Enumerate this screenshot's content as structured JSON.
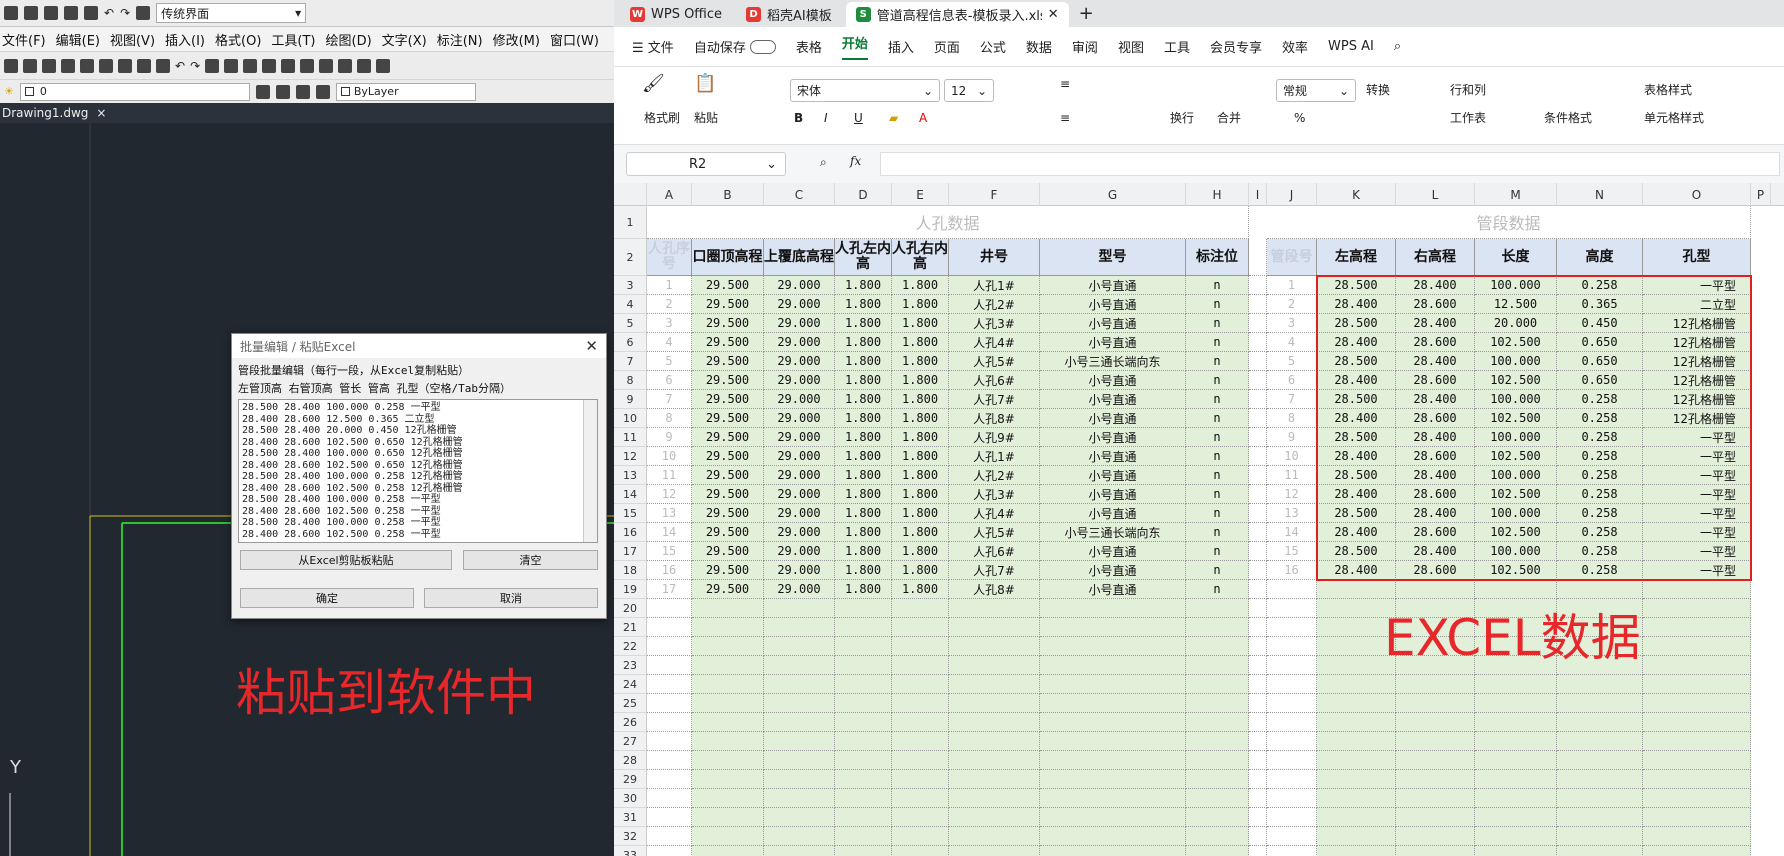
{
  "cad": {
    "workspace": "传统界面",
    "menu": [
      "文件(F)",
      "编辑(E)",
      "视图(V)",
      "插入(I)",
      "格式(O)",
      "工具(T)",
      "绘图(D)",
      "文字(X)",
      "标注(N)",
      "修改(M)",
      "窗口(W)"
    ],
    "layer_value": "0",
    "linetype": "ByLayer",
    "file_tab": "Drawing1.dwg",
    "axis_label": "Y",
    "dialog": {
      "title": "批量编辑 / 粘贴Excel",
      "desc": "管段批量编辑（每行一段，从Excel复制粘贴）",
      "columns": "左管顶高 右管顶高 管长 管高 孔型（空格/Tab分隔）",
      "lines": [
        "28.500 28.400 100.000 0.258 一平型",
        "28.400 28.600 12.500 0.365 二立型",
        "28.500 28.400 20.000 0.450 12孔格栅管",
        "28.400 28.600 102.500 0.650 12孔格栅管",
        "28.500 28.400 100.000 0.650 12孔格栅管",
        "28.400 28.600 102.500 0.650 12孔格栅管",
        "28.500 28.400 100.000 0.258 12孔格栅管",
        "28.400 28.600 102.500 0.258 12孔格栅管",
        "28.500 28.400 100.000 0.258 一平型",
        "28.400 28.600 102.500 0.258 一平型",
        "28.500 28.400 100.000 0.258 一平型",
        "28.400 28.600 102.500 0.258 一平型"
      ],
      "paste_button": "从Excel剪贴板粘贴",
      "clear_button": "清空",
      "ok_button": "确定",
      "cancel_button": "取消"
    },
    "note": "粘贴到软件中"
  },
  "wps": {
    "tabs": [
      "WPS Office",
      "稻壳AI模板",
      "管道高程信息表-模板录入.xls"
    ],
    "menu": [
      "文件",
      "自动保存",
      "表格",
      "开始",
      "插入",
      "页面",
      "公式",
      "数据",
      "审阅",
      "视图",
      "工具",
      "会员专享",
      "效率",
      "WPS AI"
    ],
    "ribbon": {
      "format_painter": "格式刷",
      "paste": "粘贴",
      "font": "宋体",
      "size": "12",
      "wrap": "换行",
      "merge": "合并",
      "number_format": "常规",
      "convert": "转换",
      "row_col": "行和列",
      "sheet": "工作表",
      "cond_format": "条件格式",
      "table_style": "表格样式",
      "cell_style": "单元格样式"
    },
    "name_box": "R2",
    "fx": "fx",
    "columns": [
      "A",
      "B",
      "C",
      "D",
      "E",
      "F",
      "G",
      "H",
      "I",
      "J",
      "K",
      "L",
      "M",
      "N",
      "O",
      "P"
    ],
    "group1": "人孔数据",
    "group2": "管段数据",
    "headers": [
      "人孔序号",
      "口圈顶高程",
      "上覆底高程",
      "人孔左内高",
      "人孔右内高",
      "井号",
      "型号",
      "标注位",
      "管段号",
      "左高程",
      "右高程",
      "长度",
      "高度",
      "孔型"
    ],
    "manholes": [
      [
        "1",
        "29.500",
        "29.000",
        "1.800",
        "1.800",
        "人孔1#",
        "小号直通",
        "n"
      ],
      [
        "2",
        "29.500",
        "29.000",
        "1.800",
        "1.800",
        "人孔2#",
        "小号直通",
        "n"
      ],
      [
        "3",
        "29.500",
        "29.000",
        "1.800",
        "1.800",
        "人孔3#",
        "小号直通",
        "n"
      ],
      [
        "4",
        "29.500",
        "29.000",
        "1.800",
        "1.800",
        "人孔4#",
        "小号直通",
        "n"
      ],
      [
        "5",
        "29.500",
        "29.000",
        "1.800",
        "1.800",
        "人孔5#",
        "小号三通长端向东",
        "n"
      ],
      [
        "6",
        "29.500",
        "29.000",
        "1.800",
        "1.800",
        "人孔6#",
        "小号直通",
        "n"
      ],
      [
        "7",
        "29.500",
        "29.000",
        "1.800",
        "1.800",
        "人孔7#",
        "小号直通",
        "n"
      ],
      [
        "8",
        "29.500",
        "29.000",
        "1.800",
        "1.800",
        "人孔8#",
        "小号直通",
        "n"
      ],
      [
        "9",
        "29.500",
        "29.000",
        "1.800",
        "1.800",
        "人孔9#",
        "小号直通",
        "n"
      ],
      [
        "10",
        "29.500",
        "29.000",
        "1.800",
        "1.800",
        "人孔1#",
        "小号直通",
        "n"
      ],
      [
        "11",
        "29.500",
        "29.000",
        "1.800",
        "1.800",
        "人孔2#",
        "小号直通",
        "n"
      ],
      [
        "12",
        "29.500",
        "29.000",
        "1.800",
        "1.800",
        "人孔3#",
        "小号直通",
        "n"
      ],
      [
        "13",
        "29.500",
        "29.000",
        "1.800",
        "1.800",
        "人孔4#",
        "小号直通",
        "n"
      ],
      [
        "14",
        "29.500",
        "29.000",
        "1.800",
        "1.800",
        "人孔5#",
        "小号三通长端向东",
        "n"
      ],
      [
        "15",
        "29.500",
        "29.000",
        "1.800",
        "1.800",
        "人孔6#",
        "小号直通",
        "n"
      ],
      [
        "16",
        "29.500",
        "29.000",
        "1.800",
        "1.800",
        "人孔7#",
        "小号直通",
        "n"
      ],
      [
        "17",
        "29.500",
        "29.000",
        "1.800",
        "1.800",
        "人孔8#",
        "小号直通",
        "n"
      ]
    ],
    "pipes": [
      [
        "1",
        "28.500",
        "28.400",
        "100.000",
        "0.258",
        "一平型"
      ],
      [
        "2",
        "28.400",
        "28.600",
        "12.500",
        "0.365",
        "二立型"
      ],
      [
        "3",
        "28.500",
        "28.400",
        "20.000",
        "0.450",
        "12孔格栅管"
      ],
      [
        "4",
        "28.400",
        "28.600",
        "102.500",
        "0.650",
        "12孔格栅管"
      ],
      [
        "5",
        "28.500",
        "28.400",
        "100.000",
        "0.650",
        "12孔格栅管"
      ],
      [
        "6",
        "28.400",
        "28.600",
        "102.500",
        "0.650",
        "12孔格栅管"
      ],
      [
        "7",
        "28.500",
        "28.400",
        "100.000",
        "0.258",
        "12孔格栅管"
      ],
      [
        "8",
        "28.400",
        "28.600",
        "102.500",
        "0.258",
        "12孔格栅管"
      ],
      [
        "9",
        "28.500",
        "28.400",
        "100.000",
        "0.258",
        "一平型"
      ],
      [
        "10",
        "28.400",
        "28.600",
        "102.500",
        "0.258",
        "一平型"
      ],
      [
        "11",
        "28.500",
        "28.400",
        "100.000",
        "0.258",
        "一平型"
      ],
      [
        "12",
        "28.400",
        "28.600",
        "102.500",
        "0.258",
        "一平型"
      ],
      [
        "13",
        "28.500",
        "28.400",
        "100.000",
        "0.258",
        "一平型"
      ],
      [
        "14",
        "28.400",
        "28.600",
        "102.500",
        "0.258",
        "一平型"
      ],
      [
        "15",
        "28.500",
        "28.400",
        "100.000",
        "0.258",
        "一平型"
      ],
      [
        "16",
        "28.400",
        "28.600",
        "102.500",
        "0.258",
        "一平型"
      ]
    ],
    "note": "EXCEL数据"
  }
}
